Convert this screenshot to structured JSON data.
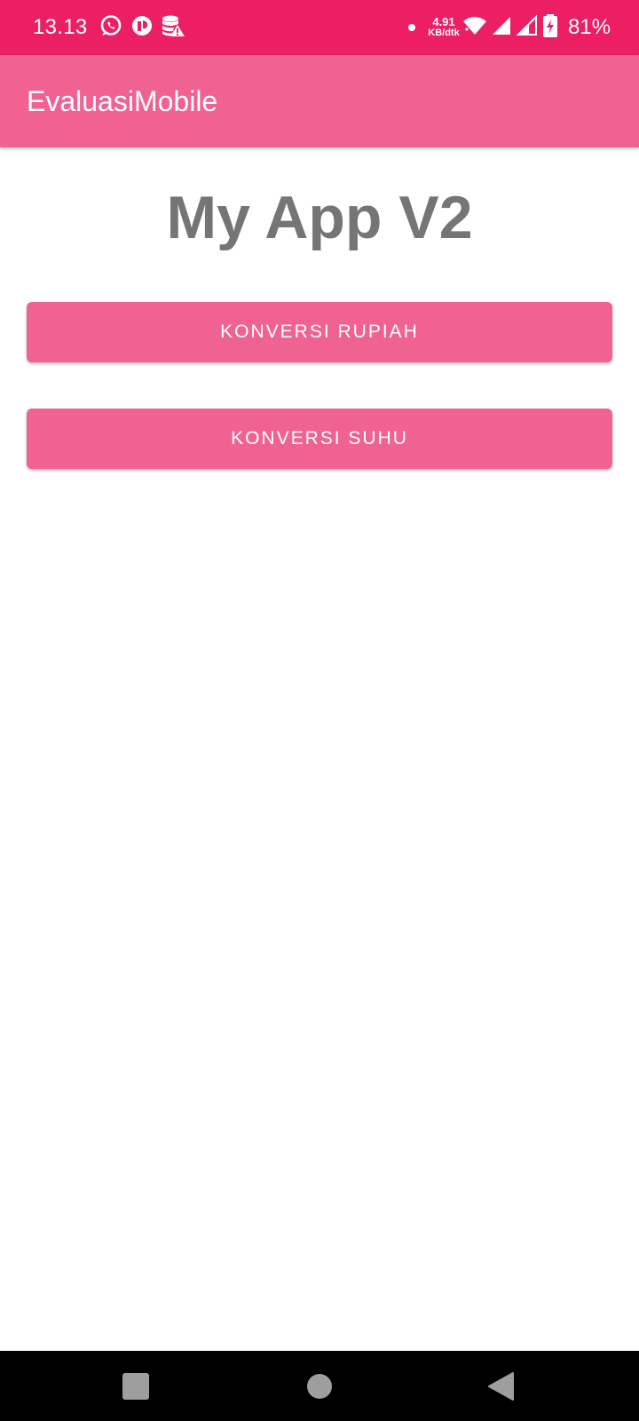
{
  "status_bar": {
    "time": "13.13",
    "net_speed_value": "4.91",
    "net_speed_unit": "KB/dtk",
    "battery_percent": "81%",
    "background_color": "#ec1e64",
    "icons": [
      "whatsapp-icon",
      "messenger-icon",
      "data-saver-warning-icon",
      "dot-icon",
      "wifi-icon",
      "signal-icon",
      "signal-2-icon",
      "battery-charging-icon"
    ]
  },
  "app_bar": {
    "title": "EvaluasiMobile",
    "background_color": "#f06292"
  },
  "main": {
    "heading": "My App V2",
    "buttons": [
      {
        "label": "KONVERSI RUPIAH"
      },
      {
        "label": "KONVERSI SUHU"
      }
    ],
    "button_color": "#f06292"
  },
  "nav_bar": {
    "icons": [
      "recents-square-icon",
      "home-circle-icon",
      "back-triangle-icon"
    ]
  }
}
